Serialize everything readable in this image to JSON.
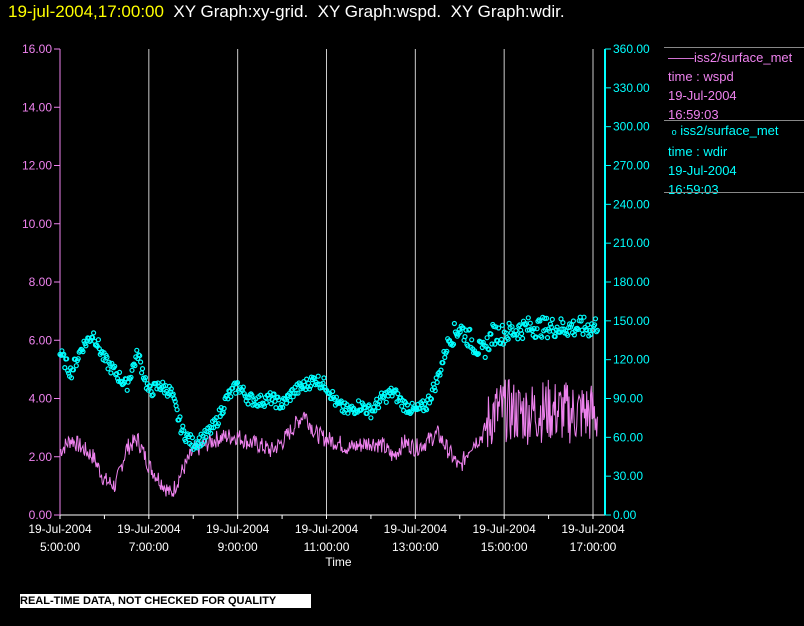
{
  "header": {
    "timestamp": "19-jul-2004,17:00:00",
    "graphs": "XY Graph:xy-grid.  XY Graph:wspd.  XY Graph:wdir."
  },
  "legend": [
    {
      "symbol": "——",
      "source": "iss2/surface_met",
      "var": "time : wspd",
      "date": "19-Jul-2004",
      "time": "16:59:03",
      "color": "#ee82ee"
    },
    {
      "symbol": "o",
      "source": "iss2/surface_met",
      "var": "time : wdir",
      "date": "19-Jul-2004",
      "time": "16:59:03",
      "color": "#00ffff"
    }
  ],
  "warning": "REAL-TIME DATA, NOT CHECKED FOR QUALITY",
  "chart_data": {
    "type": "line",
    "xlabel": "Time",
    "xlim": [
      5.0,
      17.25
    ],
    "x_ticks": [
      {
        "value": 5,
        "date": "19-Jul-2004",
        "time": "5:00:00"
      },
      {
        "value": 7,
        "date": "19-Jul-2004",
        "time": "7:00:00"
      },
      {
        "value": 9,
        "date": "19-Jul-2004",
        "time": "9:00:00"
      },
      {
        "value": 11,
        "date": "19-Jul-2004",
        "time": "11:00:00"
      },
      {
        "value": 13,
        "date": "19-Jul-2004",
        "time": "13:00:00"
      },
      {
        "value": 15,
        "date": "19-Jul-2004",
        "time": "15:00:00"
      },
      {
        "value": 17,
        "date": "19-Jul-2004",
        "time": "17:00:00"
      }
    ],
    "left_axis": {
      "ylim": [
        0,
        16
      ],
      "ticks": [
        "0.00",
        "2.00",
        "4.00",
        "6.00",
        "8.00",
        "10.00",
        "12.00",
        "14.00",
        "16.00"
      ],
      "color": "#ee82ee"
    },
    "right_axis": {
      "ylim": [
        0,
        360
      ],
      "ticks": [
        "0.00",
        "30.00",
        "60.00",
        "90.00",
        "120.00",
        "150.00",
        "180.00",
        "210.00",
        "240.00",
        "270.00",
        "300.00",
        "330.00",
        "360.00"
      ],
      "color": "#00ffff"
    },
    "grid": "vertical",
    "series": [
      {
        "name": "wspd",
        "axis": "left",
        "style": "line",
        "color": "#ee82ee",
        "x": [
          5,
          5.25,
          5.5,
          5.75,
          6,
          6.25,
          6.5,
          6.75,
          7,
          7.25,
          7.5,
          7.75,
          8,
          8.25,
          8.5,
          8.75,
          9,
          9.25,
          9.5,
          9.75,
          10,
          10.25,
          10.5,
          10.75,
          11,
          11.25,
          11.5,
          11.75,
          12,
          12.25,
          12.5,
          12.75,
          13,
          13.25,
          13.5,
          13.75,
          14,
          14.25,
          14.5,
          14.75,
          15,
          15.5,
          16,
          16.5,
          17,
          17.1
        ],
        "values": [
          2.2,
          2.6,
          2.3,
          2.0,
          1.2,
          1.0,
          2.3,
          2.6,
          1.7,
          1.2,
          0.7,
          1.5,
          2.2,
          2.4,
          2.6,
          2.7,
          2.7,
          2.5,
          2.4,
          2.2,
          2.5,
          3.0,
          3.5,
          2.8,
          2.6,
          2.5,
          2.3,
          2.4,
          2.5,
          2.4,
          2.0,
          2.5,
          2.3,
          2.5,
          2.8,
          2.2,
          1.6,
          2.4,
          2.7,
          3.5,
          3.6,
          3.5,
          3.6,
          3.5,
          3.5,
          3.4
        ]
      },
      {
        "name": "wdir",
        "axis": "right",
        "style": "markers",
        "color": "#00ffff",
        "x": [
          5,
          5.25,
          5.5,
          5.75,
          6,
          6.25,
          6.5,
          6.75,
          7,
          7.25,
          7.5,
          7.75,
          8,
          8.25,
          8.5,
          8.75,
          9,
          9.25,
          9.5,
          9.75,
          10,
          10.25,
          10.5,
          10.75,
          11,
          11.25,
          11.5,
          11.75,
          12,
          12.25,
          12.5,
          12.75,
          13,
          13.25,
          13.5,
          13.75,
          14,
          14.25,
          14.5,
          14.75,
          15,
          15.5,
          16,
          16.5,
          17,
          17.1
        ],
        "values": [
          125,
          110,
          130,
          140,
          120,
          110,
          100,
          125,
          95,
          100,
          95,
          65,
          55,
          60,
          70,
          90,
          100,
          90,
          88,
          90,
          85,
          95,
          100,
          105,
          100,
          85,
          80,
          85,
          80,
          90,
          95,
          85,
          80,
          85,
          105,
          135,
          145,
          135,
          125,
          140,
          140,
          145,
          145,
          145,
          145,
          148
        ]
      }
    ]
  }
}
